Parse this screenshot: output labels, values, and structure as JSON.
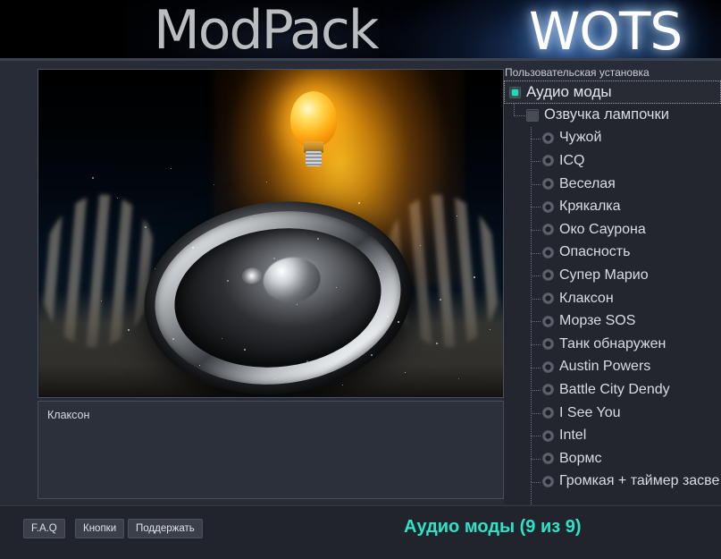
{
  "banner": {
    "logo_primary": "ModPack",
    "logo_secondary": "WOTS"
  },
  "preview": {
    "description": "Клаксон"
  },
  "tree": {
    "panel_label": "Пользовательская установка",
    "root": {
      "label": "Аудио моды",
      "control": "checkbox",
      "state": "checked",
      "selected": true
    },
    "group": {
      "label": "Озвучка лампочки",
      "control": "checkbox",
      "state": "unchecked"
    },
    "items": [
      {
        "label": "Чужой",
        "control": "radio",
        "state": "unselected"
      },
      {
        "label": "ICQ",
        "control": "radio",
        "state": "unselected"
      },
      {
        "label": "Веселая",
        "control": "radio",
        "state": "unselected"
      },
      {
        "label": "Крякалка",
        "control": "radio",
        "state": "unselected"
      },
      {
        "label": "Око Саурона",
        "control": "radio",
        "state": "unselected"
      },
      {
        "label": "Опасность",
        "control": "radio",
        "state": "unselected"
      },
      {
        "label": "Супер Марио",
        "control": "radio",
        "state": "unselected"
      },
      {
        "label": "Клаксон",
        "control": "radio",
        "state": "unselected"
      },
      {
        "label": "Морзе SOS",
        "control": "radio",
        "state": "unselected"
      },
      {
        "label": "Танк обнаружен",
        "control": "radio",
        "state": "unselected"
      },
      {
        "label": "Austin Powers",
        "control": "radio",
        "state": "unselected"
      },
      {
        "label": "Battle City Dendy",
        "control": "radio",
        "state": "unselected"
      },
      {
        "label": "I See You",
        "control": "radio",
        "state": "unselected"
      },
      {
        "label": "Intel",
        "control": "radio",
        "state": "unselected"
      },
      {
        "label": "Вормс",
        "control": "radio",
        "state": "unselected"
      },
      {
        "label": "Громкая + таймер засве",
        "control": "radio",
        "state": "unselected"
      }
    ]
  },
  "footer": {
    "faq_label": "F.A.Q",
    "buttons_label": "Кнопки",
    "support_label": "Поддержать",
    "status": "Аудио моды (9 из 9)",
    "status_color": "#2fe3c6"
  }
}
